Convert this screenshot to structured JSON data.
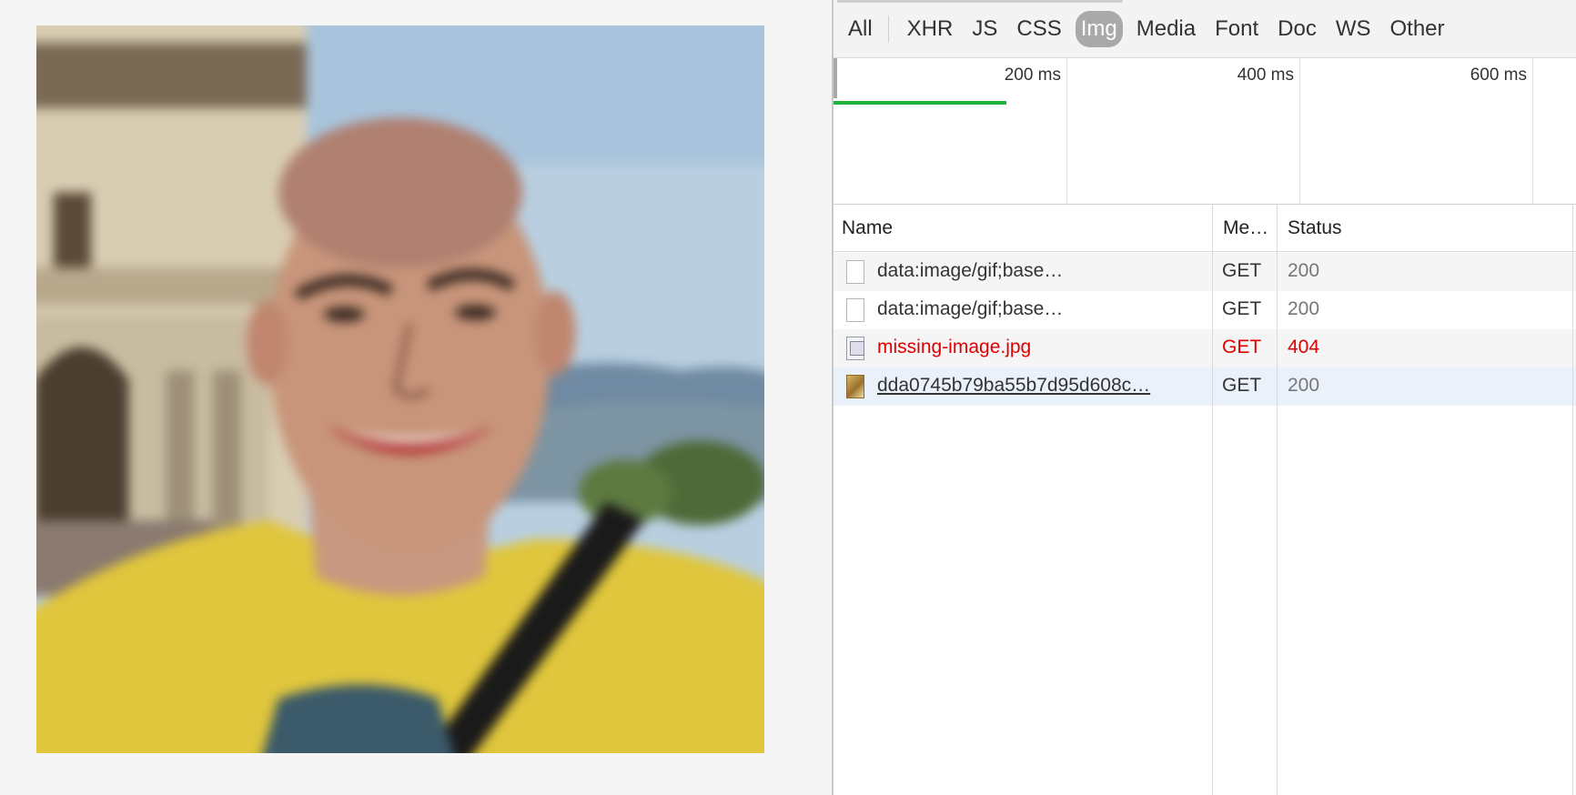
{
  "photo": {
    "alt": ""
  },
  "devtools": {
    "filters": [
      {
        "label": "All",
        "active": false
      },
      {
        "label": "XHR",
        "active": false
      },
      {
        "label": "JS",
        "active": false
      },
      {
        "label": "CSS",
        "active": false
      },
      {
        "label": "Img",
        "active": true
      },
      {
        "label": "Media",
        "active": false
      },
      {
        "label": "Font",
        "active": false
      },
      {
        "label": "Doc",
        "active": false
      },
      {
        "label": "WS",
        "active": false
      },
      {
        "label": "Other",
        "active": false
      }
    ],
    "timeline": {
      "ticks": [
        "200 ms",
        "400 ms",
        "600 ms"
      ]
    },
    "columns": {
      "name": "Name",
      "method": "Me…",
      "status": "Status"
    },
    "requests": [
      {
        "name": "data:image/gif;base…",
        "method": "GET",
        "status": "200",
        "icon": "blank-file-icon"
      },
      {
        "name": "data:image/gif;base…",
        "method": "GET",
        "status": "200",
        "icon": "blank-file-icon"
      },
      {
        "name": "missing-image.jpg",
        "method": "GET",
        "status": "404",
        "icon": "broken-image-icon"
      },
      {
        "name": "dda0745b79ba55b7d95d608c…",
        "method": "GET",
        "status": "200",
        "icon": "image-thumbnail-icon"
      }
    ],
    "colors": {
      "error": "#e00000",
      "timeline_bar": "#20b23a",
      "active_filter": "#a9a9a9"
    }
  }
}
